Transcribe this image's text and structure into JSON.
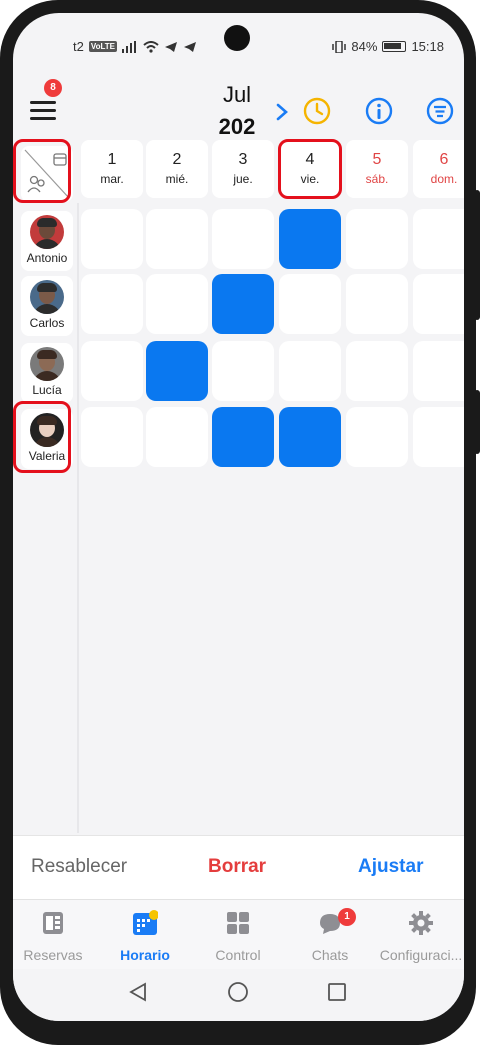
{
  "status_bar": {
    "carrier": "t2",
    "volte": "VoLTE",
    "battery": "84%",
    "time": "15:18"
  },
  "header": {
    "menu_badge": "8",
    "month": "Jul",
    "year": "202",
    "next_icon": "chevron-right-icon"
  },
  "days": [
    {
      "num": "1",
      "name": "mar.",
      "weekend": false
    },
    {
      "num": "2",
      "name": "mié.",
      "weekend": false
    },
    {
      "num": "3",
      "name": "jue.",
      "weekend": false
    },
    {
      "num": "4",
      "name": "vie.",
      "weekend": false
    },
    {
      "num": "5",
      "name": "sáb.",
      "weekend": true
    },
    {
      "num": "6",
      "name": "dom.",
      "weekend": true
    }
  ],
  "employees": [
    {
      "name": "Antonio",
      "shifts": [
        false,
        false,
        false,
        true,
        false,
        false
      ]
    },
    {
      "name": "Carlos",
      "shifts": [
        false,
        false,
        true,
        false,
        false,
        false
      ]
    },
    {
      "name": "Lucía",
      "shifts": [
        false,
        true,
        false,
        false,
        false,
        false
      ]
    },
    {
      "name": "Valeria",
      "shifts": [
        false,
        false,
        true,
        true,
        false,
        false
      ]
    }
  ],
  "actions": {
    "reset": "Resablecer",
    "delete": "Borrar",
    "adjust": "Ajustar"
  },
  "tabs": [
    {
      "label": "Reservas",
      "active": false,
      "badge": ""
    },
    {
      "label": "Horario",
      "active": true,
      "badge": ""
    },
    {
      "label": "Control",
      "active": false,
      "badge": ""
    },
    {
      "label": "Chats",
      "active": false,
      "badge": "1"
    },
    {
      "label": "Configuraci...",
      "active": false,
      "badge": ""
    }
  ],
  "colors": {
    "accent": "#1a7cf5",
    "shift": "#0a78f0",
    "weekend": "#e04545",
    "highlight": "#e4101c"
  }
}
